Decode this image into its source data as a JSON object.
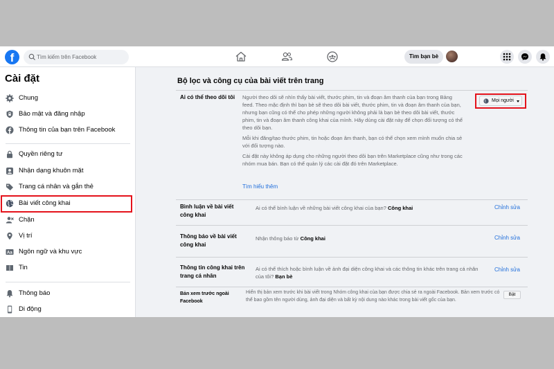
{
  "topbar": {
    "logo": "f",
    "search_placeholder": "Tìm kiếm trên Facebook",
    "find_friends": "Tìm bạn bè"
  },
  "sidebar": {
    "title": "Cài đặt",
    "items": [
      {
        "label": "Chung",
        "icon": "gear-icon"
      },
      {
        "label": "Bảo mật và đăng nhập",
        "icon": "shield-icon"
      },
      {
        "label": "Thông tin của bạn trên Facebook",
        "icon": "facebook-icon"
      },
      {
        "label": "Quyền riêng tư",
        "icon": "lock-icon"
      },
      {
        "label": "Nhận dạng khuôn mặt",
        "icon": "face-icon"
      },
      {
        "label": "Trang cá nhân và gắn thẻ",
        "icon": "tag-icon"
      },
      {
        "label": "Bài viết công khai",
        "icon": "globe-icon"
      },
      {
        "label": "Chặn",
        "icon": "block-icon"
      },
      {
        "label": "Vị trí",
        "icon": "pin-icon"
      },
      {
        "label": "Ngôn ngữ và khu vực",
        "icon": "language-icon"
      },
      {
        "label": "Tin",
        "icon": "book-icon"
      },
      {
        "label": "Thông báo",
        "icon": "bell-icon"
      },
      {
        "label": "Di động",
        "icon": "phone-icon"
      }
    ]
  },
  "content": {
    "title": "Bộ lọc và công cụ của bài viết trên trang",
    "follow": {
      "label": "Ai có thể theo dõi tôi",
      "paragraphs": [
        "Người theo dõi sẽ nhìn thấy bài viết, thước phim, tin và đoạn âm thanh của bạn trong Bảng feed. Theo mặc định thì bạn bè sẽ theo dõi bài viết, thước phim, tin và đoạn âm thanh của bạn, nhưng bạn cũng có thể cho phép những người không phải là bạn bè theo dõi bài viết, thước phim, tin và đoạn âm thanh công khai của mình. Hãy dùng cài đặt này để chọn đối tượng có thể theo dõi bạn.",
        "Mỗi khi đăng/tạo thước phim, tin hoặc đoạn âm thanh, bạn có thể chọn xem mình muốn chia sẻ với đối tượng nào.",
        "Cài đặt này không áp dụng cho những người theo dõi bạn trên Marketplace cũng như trong các nhóm mua bán. Bạn có thể quản lý các cài đặt đó trên Marketplace."
      ],
      "learn_more": "Tìm hiểu thêm",
      "dropdown_value": "Mọi người"
    },
    "comments": {
      "label": "Bình luận về bài viết công khai",
      "text": "Ai có thể bình luận về những bài viết công khai của bạn?",
      "value": "Công khai",
      "edit": "Chỉnh sửa"
    },
    "notifications": {
      "label": "Thông báo về bài viết công khai",
      "text": "Nhận thông báo từ",
      "value": "Công khai",
      "edit": "Chỉnh sửa"
    },
    "profile_info": {
      "label": "Thông tin công khai trên trang cá nhân",
      "text": "Ai có thể thích hoặc bình luận về ảnh đại diện công khai và các thông tin khác trên trang cá nhân của tôi?",
      "value": "Bạn bè",
      "edit": "Chỉnh sửa"
    },
    "preview": {
      "label": "Bản xem trước ngoài Facebook",
      "text": "Hiển thị bản xem trước khi bài viết trong Nhóm công khai của bạn được chia sẻ ra ngoài Facebook. Bản xem trước có thể bao gồm tên người dùng, ảnh đại diện và bất kỳ nội dung nào khác trong bài viết gốc của bạn.",
      "button": "Bật"
    }
  },
  "colors": {
    "brand": "#1877f2",
    "link": "#216fdb",
    "highlight": "#e4111a"
  }
}
